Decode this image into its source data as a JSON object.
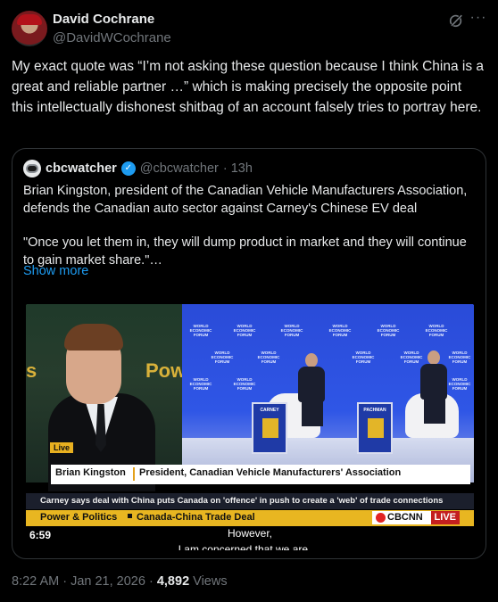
{
  "post": {
    "author_name": "David Cochrane",
    "author_handle": "@DavidWCochrane",
    "text": "My exact quote was “I’m not asking these question because I think China is a great and reliable partner …” which is making precisely the opposite point this intellectually dishonest shitbag of an account  falsely tries to portray here.",
    "timestamp": "8:22 AM · Jan 21, 2026",
    "dot": "·",
    "views_count": "4,892",
    "views_label": "Views",
    "more_glyph": "···"
  },
  "quote": {
    "name": "cbcwatcher",
    "handle": "@cbcwatcher",
    "time": "· 13h",
    "paragraph1": "Brian Kingston, president of the Canadian Vehicle Manufacturers Association, defends the Canadian auto sector against Carney's Chinese EV deal",
    "paragraph2": "\"Once you let them in, they will dump product in market and they will continue to gain market share.\"…",
    "show_more": "Show more",
    "verified_glyph": "✓"
  },
  "video": {
    "live_tag": "Live",
    "studio_text": "Pow",
    "studio_text_left": "s",
    "wef_label": "WORLD ECONOMIC FORUM",
    "sign_left": "CARNEY",
    "sign_right": "PACHMAN",
    "lower_third_name": "Brian Kingston",
    "lower_third_title": "President, Canadian Vehicle Manufacturers' Association",
    "crawl": "Carney says deal with China puts Canada on 'offence' in push to create a 'web' of trade connections",
    "ticker_show": "Power & Politics",
    "ticker_topic": "Canada-China Trade Deal",
    "network": "CBCNN",
    "network_live": "LIVE",
    "duration": "6:59",
    "caption_line1": "However,",
    "caption_line2": "I am concerned that we are …"
  },
  "colors": {
    "background": "#000000",
    "text": "#e7e9ea",
    "muted": "#71767b",
    "link": "#1d9bf0",
    "border": "#2f3336",
    "ticker": "#e8b621"
  }
}
